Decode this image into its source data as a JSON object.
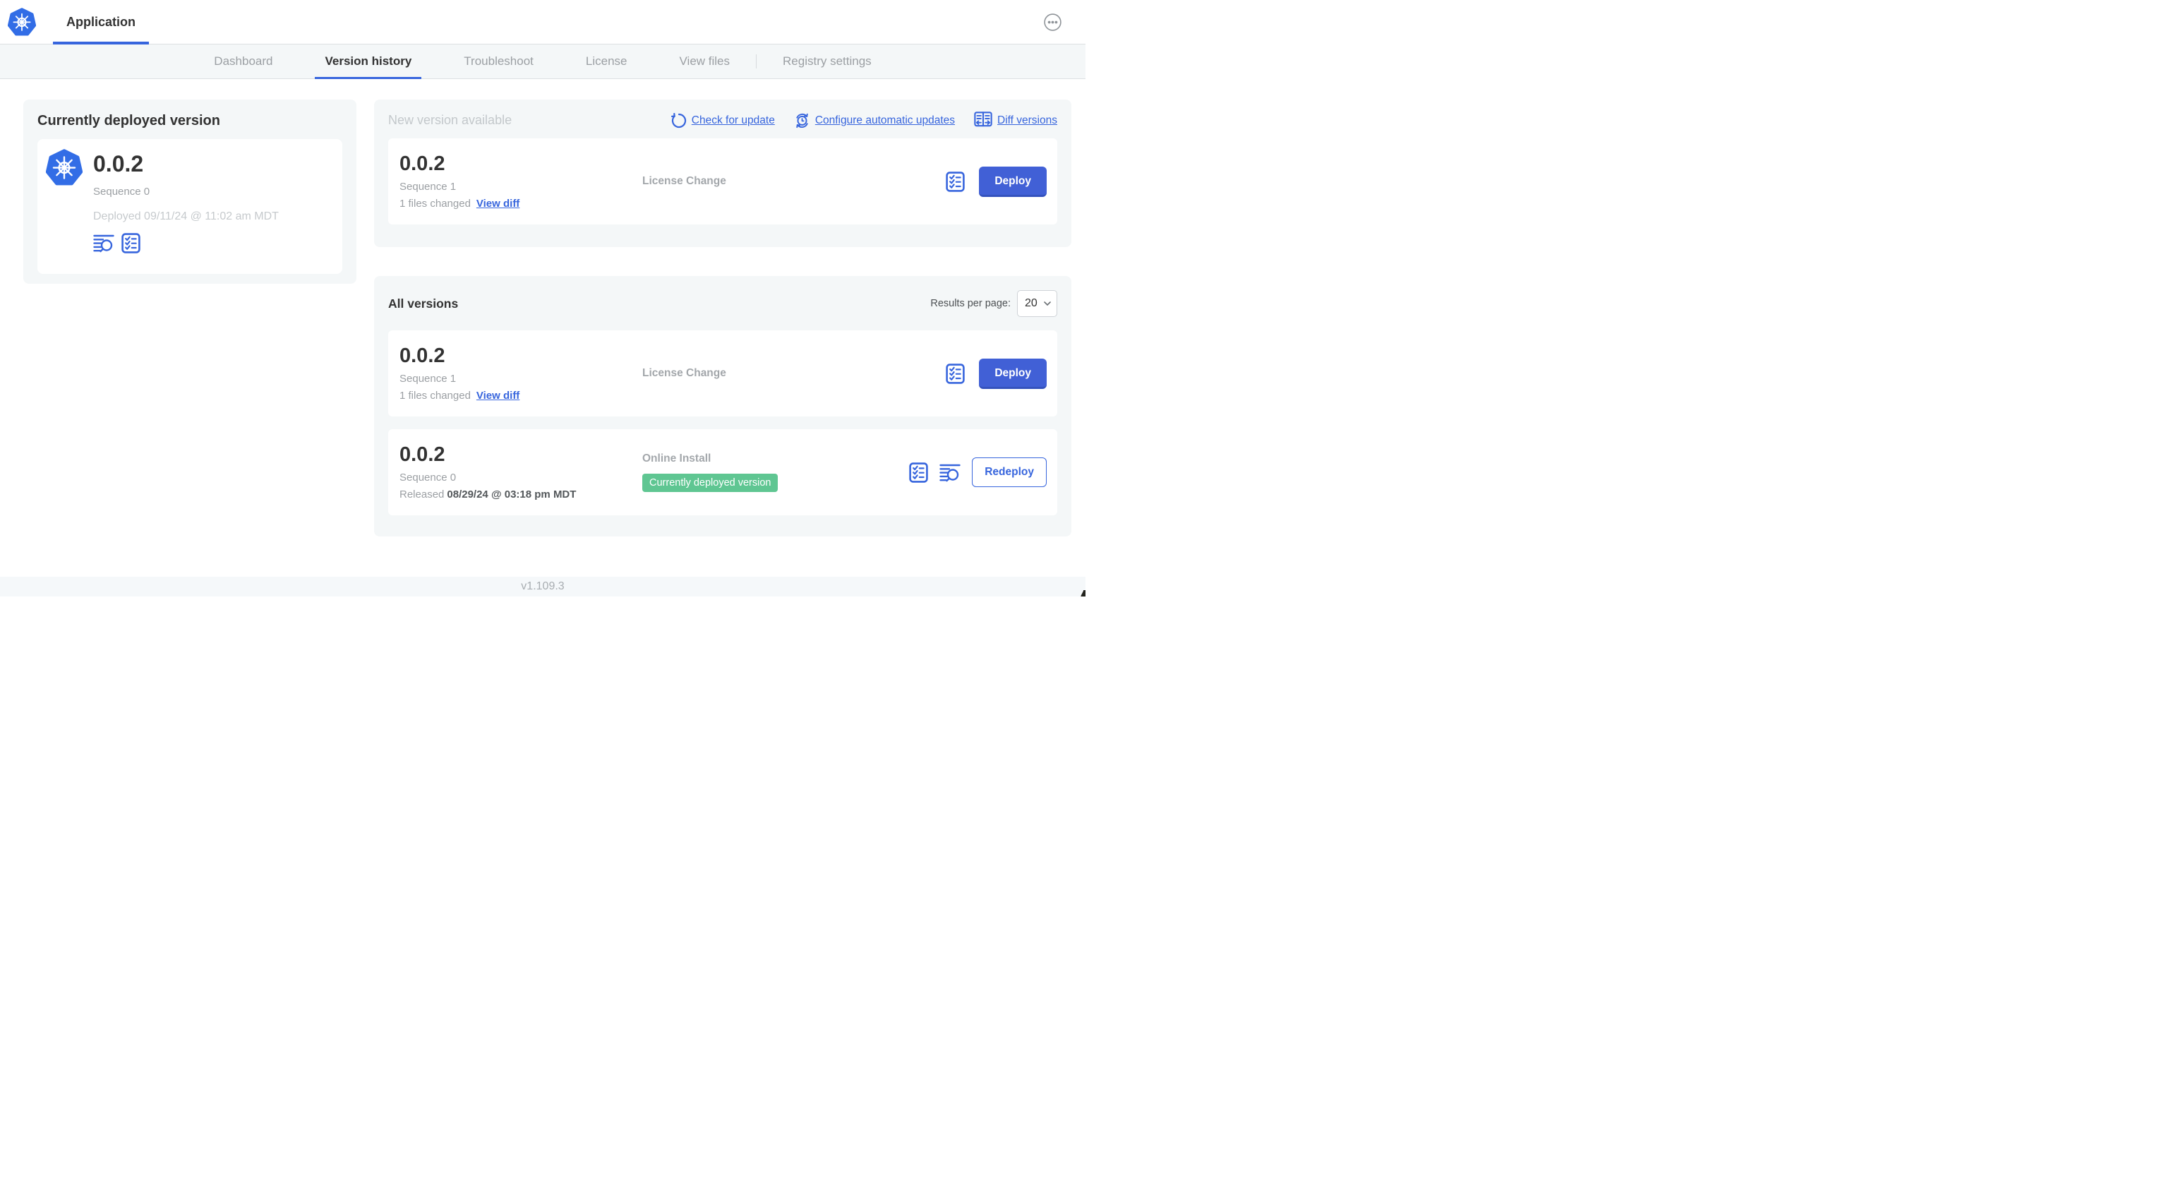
{
  "topbar": {
    "app_tab_label": "Application",
    "menu_icon": "ellipsis-circle-icon",
    "logo_icon": "kubernetes-logo"
  },
  "nav": {
    "active_tab": "Version history",
    "tabs": [
      {
        "label": "Dashboard"
      },
      {
        "label": "Version history"
      },
      {
        "label": "Troubleshoot"
      },
      {
        "label": "License"
      },
      {
        "label": "View files"
      },
      {
        "label": "Registry settings"
      }
    ]
  },
  "current_version_card": {
    "title": "Currently deployed version",
    "version": "0.0.2",
    "sequence": "Sequence 0",
    "deployed": "Deployed 09/11/24 @ 11:02 am MDT",
    "icons": [
      "logs-icon",
      "checklist-icon"
    ]
  },
  "new_version_card": {
    "title": "New version available",
    "actions": [
      {
        "label": "Check for update",
        "icon": "refresh-icon"
      },
      {
        "label": "Configure automatic updates",
        "icon": "auto-update-clock-icon"
      },
      {
        "label": "Diff versions",
        "icon": "diff-icon"
      }
    ],
    "row": {
      "version": "0.0.2",
      "sequence": "Sequence 1",
      "files_changed": "1 files changed",
      "view_diff_label": "View diff",
      "source": "License Change",
      "action_label": "Deploy",
      "icons": [
        "checklist-icon"
      ]
    }
  },
  "all_versions_card": {
    "title": "All versions",
    "results_per_page_label": "Results per page:",
    "results_per_page_value": "20",
    "rows": [
      {
        "version": "0.0.2",
        "sequence": "Sequence 1",
        "files_changed": "1 files changed",
        "view_diff_label": "View diff",
        "source": "License Change",
        "action_label": "Deploy",
        "icons": [
          "checklist-icon"
        ]
      },
      {
        "version": "0.0.2",
        "sequence": "Sequence 0",
        "released_prefix": "Released",
        "released_date": "08/29/24 @ 03:18 pm MDT",
        "source": "Online Install",
        "badge": "Currently deployed version",
        "action_label": "Redeploy",
        "icons": [
          "checklist-icon",
          "logs-icon"
        ]
      }
    ]
  },
  "footer": {
    "app_version": "v1.109.3"
  },
  "colors": {
    "accent_blue": "#3765dd",
    "button_blue": "#4160d6",
    "badge_green": "#5fc692",
    "card_bg": "#f4f7f8",
    "muted_text": "#9b9fa3",
    "faint_text": "#c6cacd"
  }
}
